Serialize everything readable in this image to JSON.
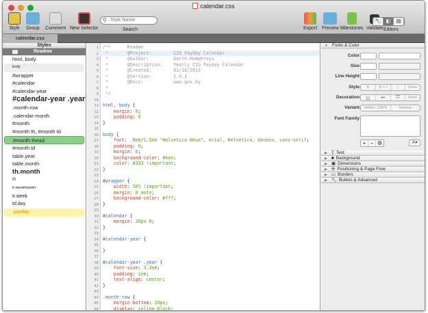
{
  "window": {
    "title": "calendar.css"
  },
  "toolbar": {
    "style": "Style",
    "group": "Group",
    "comment": "Comment",
    "new_selector": "New Selector",
    "search_placeholder": "Style Name",
    "search_label": "Search",
    "export": "Export",
    "preview": "Preview",
    "milestones": "Milestones",
    "validate": "Validate",
    "editors": "Editors"
  },
  "tab": "calendar.css",
  "sidebar": {
    "header": "Styles",
    "readme": "Readme",
    "items": [
      {
        "label": "html, body",
        "size": 7.5,
        "bold": false,
        "style": "normal"
      },
      {
        "label": "body",
        "size": 5.5,
        "bold": false,
        "style": "grey"
      },
      {
        "label": "#wrapper",
        "size": 7.5,
        "bold": false,
        "style": "normal"
      },
      {
        "label": "#calendar",
        "size": 7.5,
        "bold": false,
        "style": "normal"
      },
      {
        "label": "#calendar-year",
        "size": 7.5,
        "bold": false,
        "style": "normal"
      },
      {
        "label": "#calendar-year .year",
        "size": 11,
        "bold": true,
        "style": "normal"
      },
      {
        "label": ".month-row",
        "size": 7.5,
        "bold": false,
        "style": "normal"
      },
      {
        "label": ".calendar-month",
        "size": 7.5,
        "bold": false,
        "style": "normal"
      },
      {
        "label": "#month",
        "size": 7.5,
        "bold": false,
        "style": "normal"
      },
      {
        "label": "#month th, #month td",
        "size": 7.5,
        "bold": false,
        "style": "normal"
      },
      {
        "label": "#month thead",
        "size": 7.5,
        "bold": false,
        "style": "green"
      },
      {
        "label": "#month td",
        "size": 7.5,
        "bold": false,
        "style": "normal"
      },
      {
        "label": "table.year",
        "size": 7.5,
        "bold": false,
        "style": "normal"
      },
      {
        "label": "table.month",
        "size": 7.5,
        "bold": false,
        "style": "normal"
      },
      {
        "label": "th.month",
        "size": 9.5,
        "bold": true,
        "style": "normal"
      },
      {
        "label": "th",
        "size": 6,
        "bold": false,
        "style": "normal"
      },
      {
        "label": "tr.weekheader",
        "size": 5.5,
        "bold": false,
        "style": "normal"
      },
      {
        "label": "tr.week",
        "size": 7,
        "bold": false,
        "style": "normal"
      },
      {
        "label": "td.day",
        "size": 7,
        "bold": false,
        "style": "normal"
      },
      {
        "label": ".payday",
        "size": 7,
        "bold": false,
        "style": "yellow"
      }
    ]
  },
  "editor": {
    "current_line": 2,
    "lines": [
      [
        [
          "cmt",
          "/**      Readme"
        ]
      ],
      [
        [
          "cmt",
          " *       @Project:        CIG Payday Calendar"
        ]
      ],
      [
        [
          "cmt",
          " *       @Author:         Garth Humphreys"
        ]
      ],
      [
        [
          "cmt",
          " *       @Description:    Yearly CIG Payday Calendar"
        ]
      ],
      [
        [
          "cmt",
          " *       @Created:        01/18/2013"
        ]
      ],
      [
        [
          "cmt",
          " *       @Version:        1.0.1"
        ]
      ],
      [
        [
          "cmt",
          " *       @Docs:           www.gov.ky"
        ]
      ],
      [
        [
          "cmt",
          " *"
        ]
      ],
      [
        [
          "cmt",
          " */"
        ]
      ],
      [],
      [
        [
          "sel",
          "html, body"
        ],
        [
          "pun",
          " {"
        ]
      ],
      [
        [
          "prop",
          "    margin"
        ],
        [
          "pun",
          ": "
        ],
        [
          "val",
          "0"
        ],
        [
          "pun",
          ";"
        ]
      ],
      [
        [
          "prop",
          "    padding"
        ],
        [
          "pun",
          ": "
        ],
        [
          "val",
          "0"
        ]
      ],
      [
        [
          "pun",
          "}"
        ]
      ],
      [],
      [
        [
          "sel",
          "body"
        ],
        [
          "pun",
          " {"
        ]
      ],
      [
        [
          "prop",
          "    font"
        ],
        [
          "pun",
          ": "
        ],
        [
          "val",
          ".8em/1.5em \"Helvetica Neue\", Arial, Helvetica, Geneva, sans-serif"
        ],
        [
          "pun",
          ";"
        ]
      ],
      [
        [
          "prop",
          "    padding"
        ],
        [
          "pun",
          ": "
        ],
        [
          "val",
          "0"
        ],
        [
          "pun",
          ";"
        ]
      ],
      [
        [
          "prop",
          "    margin"
        ],
        [
          "pun",
          ": "
        ],
        [
          "val",
          "0"
        ],
        [
          "pun",
          ";"
        ]
      ],
      [
        [
          "prop",
          "    background-color"
        ],
        [
          "pun",
          ": "
        ],
        [
          "val",
          "#eee"
        ],
        [
          "pun",
          ";"
        ]
      ],
      [
        [
          "prop",
          "    color"
        ],
        [
          "pun",
          ": "
        ],
        [
          "val",
          "#333 !important"
        ],
        [
          "pun",
          ";"
        ]
      ],
      [
        [
          "pun",
          "}"
        ]
      ],
      [],
      [
        [
          "sel",
          "#wrapper"
        ],
        [
          "pun",
          " {"
        ]
      ],
      [
        [
          "prop",
          "    width"
        ],
        [
          "pun",
          ": "
        ],
        [
          "val",
          "56% !important"
        ],
        [
          "pun",
          ";"
        ]
      ],
      [
        [
          "prop",
          "    margin"
        ],
        [
          "pun",
          ": "
        ],
        [
          "val",
          "0 auto"
        ],
        [
          "pun",
          ";"
        ]
      ],
      [
        [
          "prop",
          "    background-color"
        ],
        [
          "pun",
          ": "
        ],
        [
          "val",
          "#fff"
        ],
        [
          "pun",
          ";"
        ]
      ],
      [
        [
          "pun",
          "}"
        ]
      ],
      [],
      [
        [
          "sel",
          "#calendar"
        ],
        [
          "pun",
          " {"
        ]
      ],
      [
        [
          "prop",
          "    margin"
        ],
        [
          "pun",
          ": "
        ],
        [
          "val",
          "20px 0"
        ],
        [
          "pun",
          ";"
        ]
      ],
      [
        [
          "pun",
          "}"
        ]
      ],
      [],
      [
        [
          "sel",
          "#calendar-year"
        ],
        [
          "pun",
          " {"
        ]
      ],
      [],
      [
        [
          "pun",
          "}"
        ]
      ],
      [],
      [
        [
          "sel",
          "#calendar-year .year"
        ],
        [
          "pun",
          " {"
        ]
      ],
      [
        [
          "prop",
          "    font-size"
        ],
        [
          "pun",
          ": "
        ],
        [
          "val",
          "3.3em"
        ],
        [
          "pun",
          ";"
        ]
      ],
      [
        [
          "prop",
          "    padding"
        ],
        [
          "pun",
          ": "
        ],
        [
          "val",
          "1em"
        ],
        [
          "pun",
          ";"
        ]
      ],
      [
        [
          "prop",
          "    text-align"
        ],
        [
          "pun",
          ": "
        ],
        [
          "val",
          "center"
        ],
        [
          "pun",
          ";"
        ]
      ],
      [
        [
          "pun",
          "}"
        ]
      ],
      [],
      [
        [
          "sel",
          ".month-row"
        ],
        [
          "pun",
          " {"
        ]
      ],
      [
        [
          "prop",
          "    margin-bottom"
        ],
        [
          "pun",
          ": "
        ],
        [
          "val",
          "20px"
        ],
        [
          "pun",
          ";"
        ]
      ],
      [
        [
          "prop",
          "    display"
        ],
        [
          "pun",
          ": "
        ],
        [
          "val",
          "inline-block"
        ],
        [
          "pun",
          ";"
        ]
      ]
    ]
  },
  "inspector": {
    "fonts_color": "Fonts & Color",
    "color": "Color:",
    "size": "Size:",
    "line_height": "Line Height:",
    "style": "Style:",
    "decoration": "Decoration:",
    "variant": "Variant:",
    "font_family": "Font Family:",
    "style_opts": [
      "B",
      "B + I",
      "I",
      "None"
    ],
    "decoration_opts": [
      "aa",
      "aa",
      "aa",
      "None"
    ],
    "variant_opts": [
      "SMALL CAPS",
      "Normal"
    ],
    "sections": [
      "Text",
      "Background",
      "Dimensions",
      "Positioning & Page Flow",
      "Borders",
      "Bullets & Advanced"
    ]
  }
}
